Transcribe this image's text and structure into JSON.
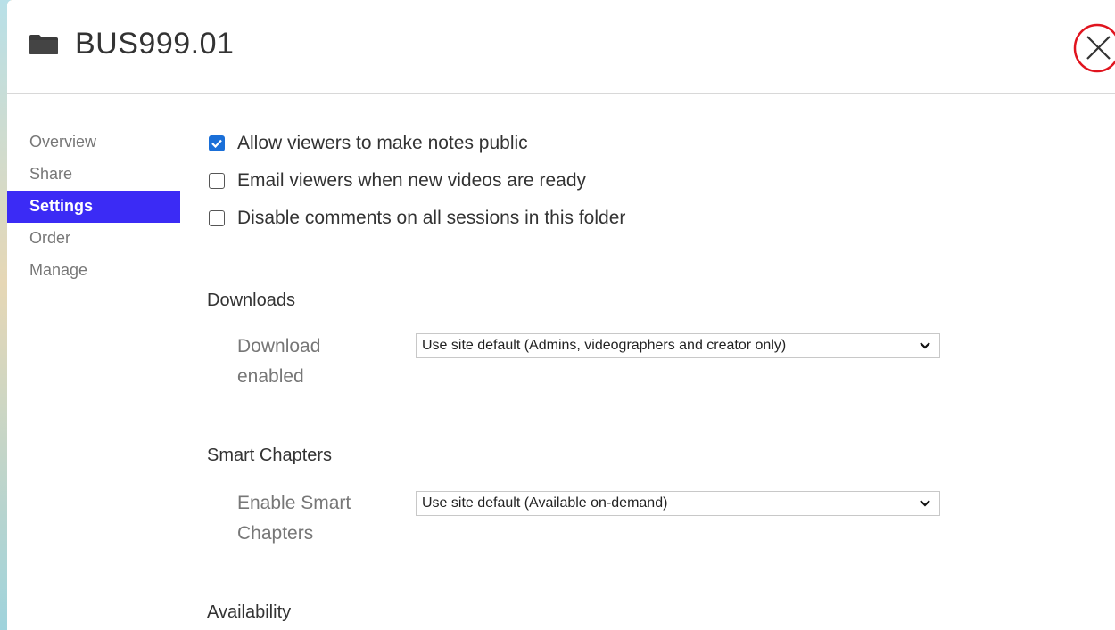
{
  "header": {
    "title": "BUS999.01",
    "folder_icon": "folder-icon",
    "close_icon": "close-icon",
    "close_circle_color": "#e0141e"
  },
  "sidebar": {
    "items": [
      {
        "label": "Overview",
        "active": false
      },
      {
        "label": "Share",
        "active": false
      },
      {
        "label": "Settings",
        "active": true
      },
      {
        "label": "Order",
        "active": false
      },
      {
        "label": "Manage",
        "active": false
      }
    ],
    "active_color": "#3b2bf5"
  },
  "settings": {
    "checkboxes": [
      {
        "label": "Allow viewers to make notes public",
        "checked": true
      },
      {
        "label": "Email viewers when new videos are ready",
        "checked": false
      },
      {
        "label": "Disable comments on all sessions in this folder",
        "checked": false
      }
    ],
    "downloads": {
      "heading": "Downloads",
      "label": "Download enabled",
      "value": "Use site default (Admins, videographers and creator only)"
    },
    "smart_chapters": {
      "heading": "Smart Chapters",
      "label": "Enable Smart Chapters",
      "value": "Use site default (Available on-demand)"
    },
    "availability": {
      "heading": "Availability"
    }
  }
}
